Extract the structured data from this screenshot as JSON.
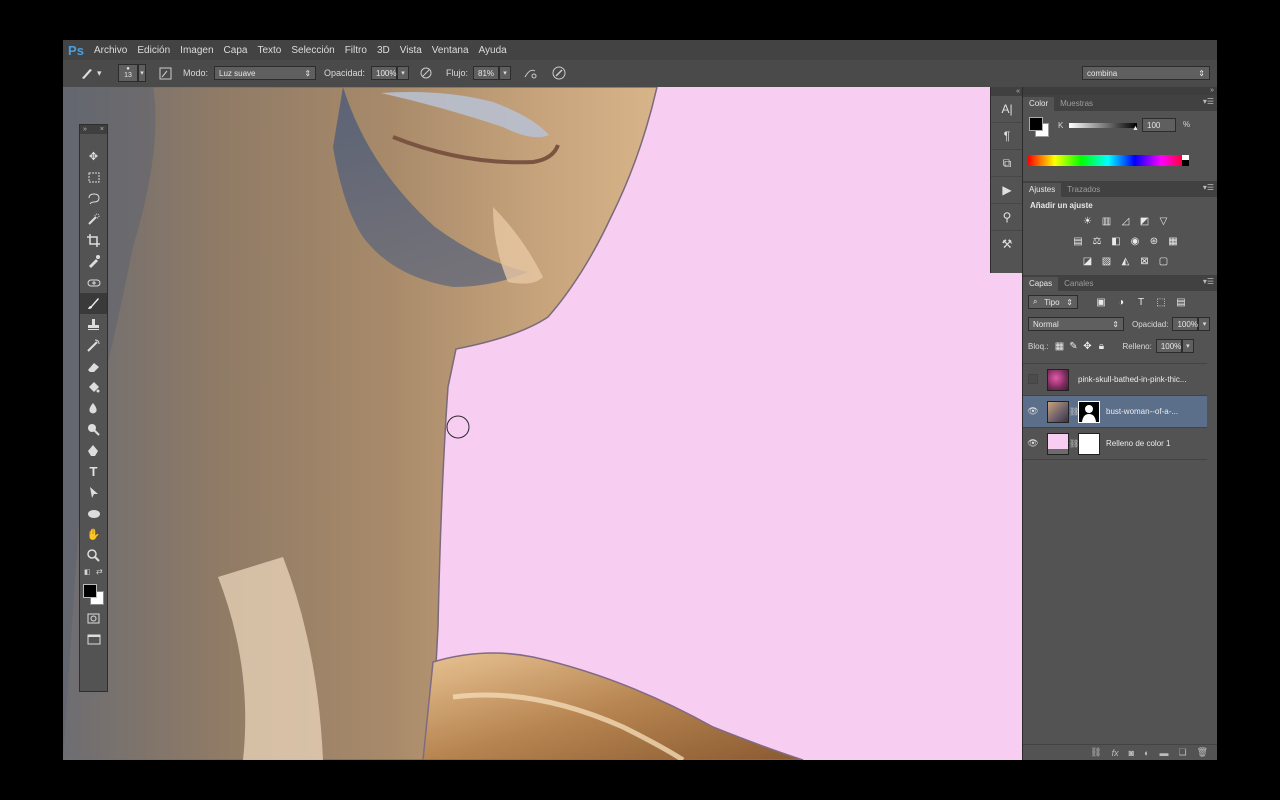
{
  "app": {
    "logo": "Ps",
    "accent": "#4a9fe0"
  },
  "menu": [
    "Archivo",
    "Edición",
    "Imagen",
    "Capa",
    "Texto",
    "Selección",
    "Filtro",
    "3D",
    "Vista",
    "Ventana",
    "Ayuda"
  ],
  "options": {
    "brush_size": "13",
    "mode_label": "Modo:",
    "mode_value": "Luz suave",
    "opacity_label": "Opacidad:",
    "opacity_value": "100%",
    "flow_label": "Flujo:",
    "flow_value": "81%",
    "workspace": "combina"
  },
  "toolbox": {
    "tools": [
      "move-tool-icon",
      "marquee-tool-icon",
      "lasso-tool-icon",
      "quick-selection-icon",
      "crop-tool-icon",
      "eyedropper-icon",
      "healing-brush-icon",
      "brush-tool-icon",
      "clone-stamp-icon",
      "history-brush-icon",
      "eraser-icon",
      "paint-bucket-icon",
      "blur-tool-icon",
      "dodge-tool-icon",
      "pen-tool-icon",
      "type-tool-icon",
      "path-selection-icon",
      "ellipse-tool-icon",
      "hand-tool-icon",
      "zoom-tool-icon"
    ],
    "active_tool": "brush-tool-icon",
    "foreground_color": "#000000",
    "background_color": "#ffffff"
  },
  "color_panel": {
    "tabs": [
      "Color",
      "Muestras"
    ],
    "channel": "K",
    "value": "100",
    "unit": "%"
  },
  "adjustments_panel": {
    "tabs": [
      "Ajustes",
      "Trazados"
    ],
    "heading": "Añadir un ajuste"
  },
  "layers_panel": {
    "tabs": [
      "Capas",
      "Canales"
    ],
    "filter": "Tipo",
    "blend_mode": "Normal",
    "opacity_label": "Opacidad:",
    "opacity_value": "100%",
    "lock_label": "Bloq.:",
    "fill_label": "Relleno:",
    "fill_value": "100%",
    "layers": [
      {
        "name": "pink-skull-bathed-in-pink-thic...",
        "visible": false,
        "has_mask": false,
        "selected": false
      },
      {
        "name": "bust-woman--of-a-...",
        "visible": true,
        "has_mask": true,
        "selected": true
      },
      {
        "name": "Relleno de color 1",
        "visible": true,
        "has_mask": true,
        "selected": false
      }
    ]
  },
  "canvas": {
    "background_color": "#f8cdf2"
  }
}
